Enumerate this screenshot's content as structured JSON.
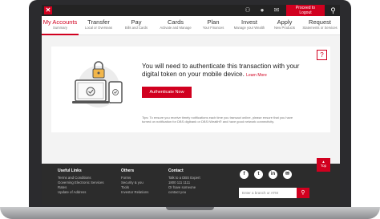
{
  "topbar": {
    "logout_line1": "Proceed to",
    "logout_line2": "Logout"
  },
  "nav": {
    "items": [
      {
        "title": "My Accounts",
        "sub": "Summary"
      },
      {
        "title": "Transfer",
        "sub": "Local or Overseas"
      },
      {
        "title": "Pay",
        "sub": "Bills and Cards"
      },
      {
        "title": "Cards",
        "sub": "Activate and Manage"
      },
      {
        "title": "Plan",
        "sub": "Your Finances"
      },
      {
        "title": "Invest",
        "sub": "Manage your Wealth"
      },
      {
        "title": "Apply",
        "sub": "New Products"
      },
      {
        "title": "Request",
        "sub": "Statements or Services"
      }
    ]
  },
  "main": {
    "help_label": "?",
    "message": "You will need to authenticate this transaction with your digital token on your mobile device.",
    "learn_more": "Learn More",
    "auth_button": "Authenticate Now",
    "tip": "Tips: To ensure you receive timely notifications each time you transact online, please ensure that you have turned on notification for DBS digibank or DBS iWealth® and have good network connectivity."
  },
  "footer": {
    "useful_links": {
      "heading": "Useful Links",
      "links": [
        "Terms and Conditions",
        "Governing Electronic Services",
        "Rates",
        "Update of Address"
      ]
    },
    "others": {
      "heading": "Others",
      "links": [
        "Forms",
        "Security & you",
        "Tools",
        "Investor Relations"
      ]
    },
    "contact": {
      "heading": "Contact",
      "lines": [
        "Talk to a DBS Expert",
        "1800 111 1111",
        "Or have someone",
        "contact you"
      ]
    },
    "branch_placeholder": "Enter a branch or ATM",
    "top_label": "Top"
  },
  "icons": {
    "brand_color": "#d1001f"
  }
}
